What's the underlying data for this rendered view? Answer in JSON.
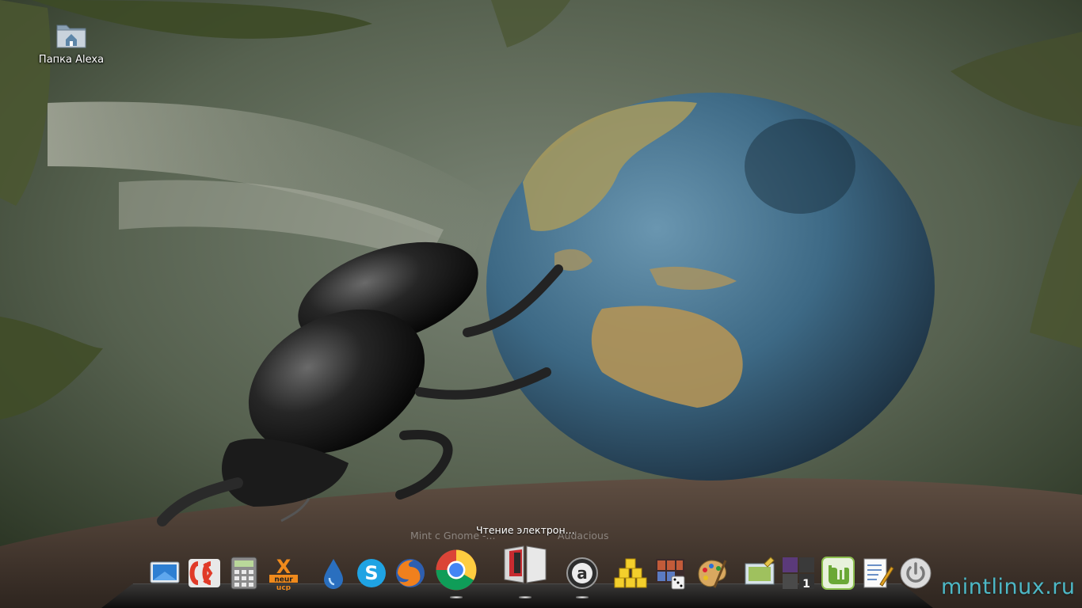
{
  "desktop": {
    "icons": [
      {
        "label": "Папка Alexa",
        "icon": "home-folder-icon"
      }
    ]
  },
  "dock": {
    "active_label": "Чтение электрон...",
    "neighbor_labels": [
      "Mint с Gnome -...",
      "Audacious"
    ],
    "items": [
      {
        "name": "show-desktop",
        "icon": "desktop-icon"
      },
      {
        "name": "doublecmd",
        "icon": "double-commander-icon"
      },
      {
        "name": "calculator",
        "icon": "calculator-icon"
      },
      {
        "name": "xneur",
        "icon": "xneur-icon",
        "text_top": "X",
        "text_mid": "neur",
        "text_bot": "ucp"
      },
      {
        "name": "deluge",
        "icon": "deluge-drop-icon"
      },
      {
        "name": "skype",
        "icon": "skype-icon",
        "text": "S"
      },
      {
        "name": "firefox",
        "icon": "firefox-icon"
      },
      {
        "name": "chrome",
        "icon": "chrome-icon"
      },
      {
        "name": "ebook-reader",
        "icon": "ebook-reader-icon"
      },
      {
        "name": "audacious",
        "icon": "audacious-icon",
        "text": "a"
      },
      {
        "name": "mahjongg",
        "icon": "mahjongg-icon"
      },
      {
        "name": "games",
        "icon": "games-icon"
      },
      {
        "name": "gimp",
        "icon": "palette-icon"
      },
      {
        "name": "screenshot",
        "icon": "screenshot-icon"
      },
      {
        "name": "workspaces",
        "icon": "workspace-switcher-icon",
        "text": "1"
      },
      {
        "name": "mintmenu",
        "icon": "linux-mint-icon"
      },
      {
        "name": "text-editor",
        "icon": "text-editor-icon"
      },
      {
        "name": "shutdown",
        "icon": "power-icon"
      }
    ]
  },
  "watermark": "mintlinux.ru",
  "colors": {
    "watermark": "#4db8c6",
    "dock_shelf": "#1a1a1a"
  }
}
